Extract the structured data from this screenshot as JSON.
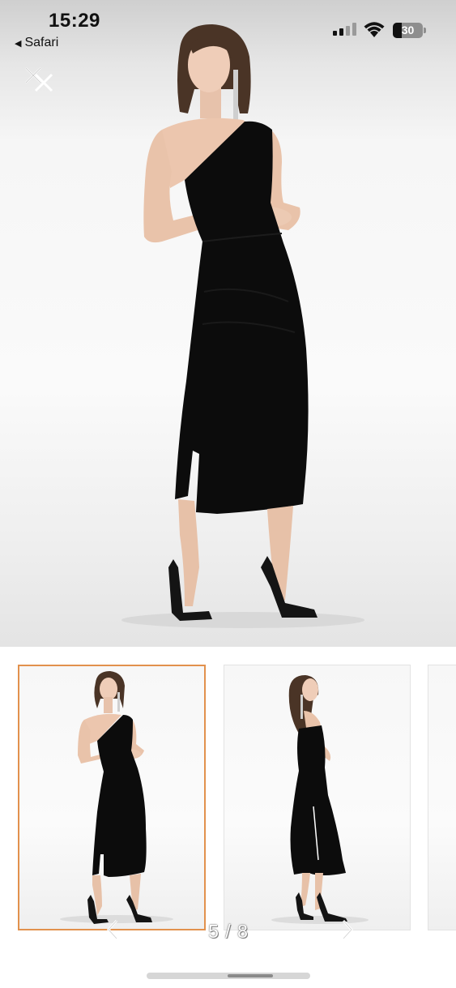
{
  "status_bar": {
    "time": "15:29",
    "back_app": "Safari",
    "battery_level": "30",
    "battery_fraction": 0.3,
    "signal_bars_active": 2,
    "signal_bars_total": 4
  },
  "viewer": {
    "close_icon": "close-icon",
    "page_counter": "5 / 8",
    "current_page": 5,
    "total_pages": 8,
    "prev_icon": "chevron-left-icon",
    "next_icon": "chevron-right-icon"
  },
  "thumbnails": [
    {
      "name": "thumbnail-front-view",
      "selected": true
    },
    {
      "name": "thumbnail-side-view",
      "selected": false
    },
    {
      "name": "thumbnail-partial",
      "selected": false
    }
  ],
  "colors": {
    "selected_border": "#e2914d",
    "dress": "#0c0c0c"
  }
}
